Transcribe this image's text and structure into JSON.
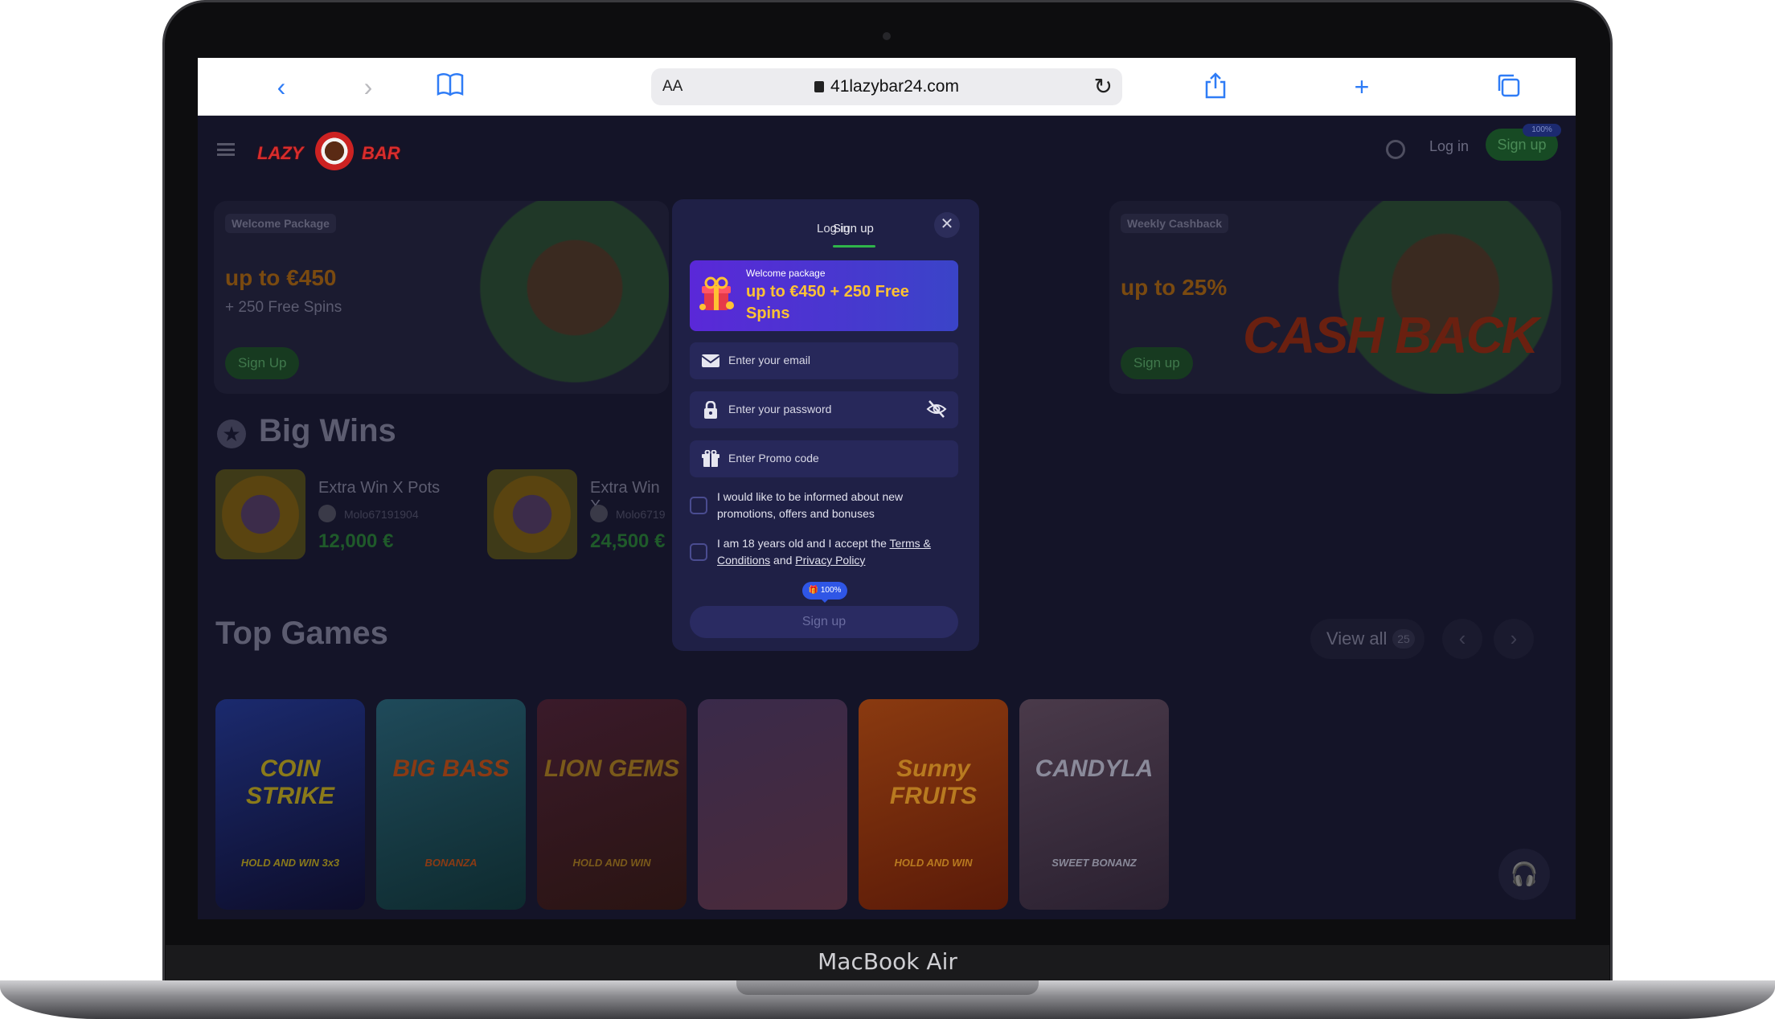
{
  "device": {
    "label": "MacBook Air"
  },
  "browser": {
    "text_size_label": "AA",
    "url": "41lazybar24.com"
  },
  "site": {
    "header": {
      "logo_left": "LAZY",
      "logo_right": "BAR",
      "login_label": "Log in",
      "signup_label": "Sign up",
      "signup_badge": "100%"
    },
    "promos": [
      {
        "tag": "Welcome Package",
        "title": "up to €450",
        "subtitle": "+ 250 Free Spins",
        "button": "Sign Up"
      },
      {
        "tag": "Weekly Cashback",
        "title": "up to 25%",
        "subtitle": "",
        "button": "Sign up",
        "art_text": "CASH BACK"
      }
    ],
    "big_wins": {
      "title": "Big Wins",
      "items": [
        {
          "game": "Extra Win X Pots",
          "user": "Molo67191904",
          "amount": "12,000 €"
        },
        {
          "game": "Extra Win X",
          "user": "Molo6719",
          "amount": "24,500 €"
        }
      ]
    },
    "top_games": {
      "title": "Top Games",
      "view_all": "View all",
      "count": "25",
      "games": [
        {
          "title": "COIN STRIKE",
          "subtitle": "HOLD AND WIN 3x3",
          "colors": [
            "#1b2a6e",
            "#0d0d2a"
          ],
          "text_color": "#8a7a1a"
        },
        {
          "title": "BIG BASS",
          "subtitle": "BONANZA",
          "colors": [
            "#1f4a5a",
            "#0e2a2e"
          ],
          "text_color": "#8a3a14"
        },
        {
          "title": "LION GEMS",
          "subtitle": "HOLD AND WIN",
          "colors": [
            "#3a1a2a",
            "#2a1412"
          ],
          "text_color": "#7a5a1a"
        },
        {
          "title": "",
          "subtitle": "",
          "colors": [
            "#3a2a4a",
            "#4a2a3a"
          ],
          "text_color": "#6a4a6a"
        },
        {
          "title": "Sunny FRUITS",
          "subtitle": "HOLD AND WIN",
          "colors": [
            "#8a3a10",
            "#5a1a08"
          ],
          "text_color": "#b87a20"
        },
        {
          "title": "CANDYLA",
          "subtitle": "SWEET BONANZ",
          "colors": [
            "#4a3a4a",
            "#2a2030"
          ],
          "text_color": "#8a8a9a"
        }
      ]
    }
  },
  "modal": {
    "tabs": {
      "login": "Log in",
      "signup": "Sign up"
    },
    "banner": {
      "small": "Welcome package",
      "big": "up to €450 + 250 Free Spins"
    },
    "fields": {
      "email_placeholder": "Enter your email",
      "password_placeholder": "Enter your password",
      "promo_placeholder": "Enter Promo code"
    },
    "checkboxes": {
      "marketing": "I would like to be informed about new promotions, offers and bonuses",
      "age_prefix": "I am 18 years old and I accept the ",
      "terms_link": "Terms & Conditions",
      "and": " and ",
      "privacy_link": "Privacy Policy"
    },
    "pill": "100%",
    "submit": "Sign up"
  },
  "colors": {
    "accent_green": "#2fb54a",
    "modal_bg": "#1f2046",
    "banner_gold": "#ffc233",
    "safari_blue": "#2f7cf6"
  }
}
